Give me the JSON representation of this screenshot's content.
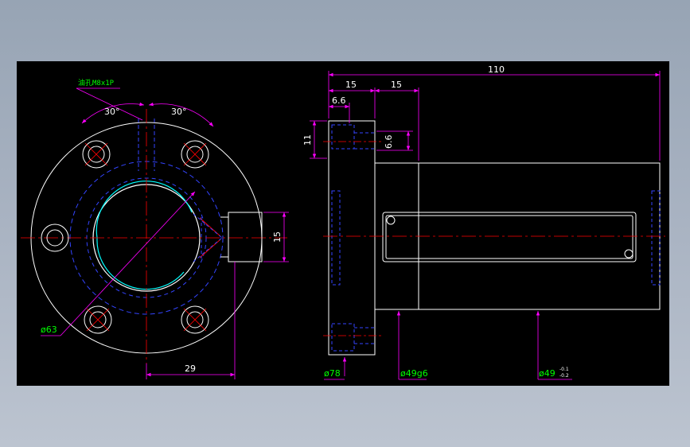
{
  "colors": {
    "background": "#000000",
    "outline": "#ffffff",
    "dimension": "#ff00ff",
    "centerline": "#ff0000",
    "hidden": "#0000ff",
    "thread": "#00ffff",
    "label": "#00ff00",
    "desktop_top": "#97a4b4",
    "desktop_bottom": "#bcc4d0"
  },
  "front_view": {
    "oil_hole_label": "油孔M8x1P",
    "angle_left": "30°",
    "angle_right": "30°",
    "dim_15": "15",
    "dim_29": "29",
    "dim_phi63": "ø63"
  },
  "side_view": {
    "dim_110": "110",
    "dim_15_a": "15",
    "dim_15_b": "15",
    "dim_6_6_a": "6.6",
    "dim_6_6_b": "6.6",
    "dim_11": "11",
    "dim_phi78": "ø78",
    "dim_phi49g6": "ø49g6",
    "dim_phi49": "ø49",
    "tol_upper": "-0.1",
    "tol_lower": "-0.2"
  }
}
